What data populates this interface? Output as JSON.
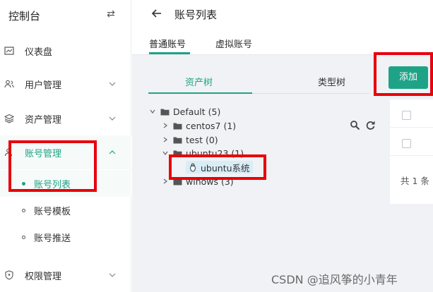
{
  "sidebar": {
    "title": "控制台",
    "menu": [
      {
        "key": "dashboard",
        "label": "仪表盘"
      },
      {
        "key": "users",
        "label": "用户管理"
      },
      {
        "key": "assets",
        "label": "资产管理"
      },
      {
        "key": "accounts",
        "label": "账号管理",
        "active": true
      },
      {
        "key": "permissions",
        "label": "权限管理"
      }
    ],
    "account_sub": [
      {
        "label": "账号列表",
        "active": true
      },
      {
        "label": "账号模板"
      },
      {
        "label": "账号推送"
      }
    ]
  },
  "header": {
    "title": "账号列表",
    "tabs": [
      {
        "label": "普通账号",
        "active": true
      },
      {
        "label": "虚拟账号"
      }
    ]
  },
  "tree_tabs": [
    {
      "label": "资产树",
      "active": true
    },
    {
      "label": "类型树"
    }
  ],
  "add_button": "添加",
  "tree": {
    "root": "Default (5)",
    "children": [
      "centos7 (1)",
      "test (0)",
      "ubuntu23 (1)",
      "winows (3)"
    ],
    "ubuntu_child": "ubuntu系统"
  },
  "table": {
    "total": "共 1 条"
  },
  "colors": {
    "accent": "#1fa386",
    "highlight_box": "#e8000b"
  },
  "watermark": "CSDN @追风筝的小青年"
}
